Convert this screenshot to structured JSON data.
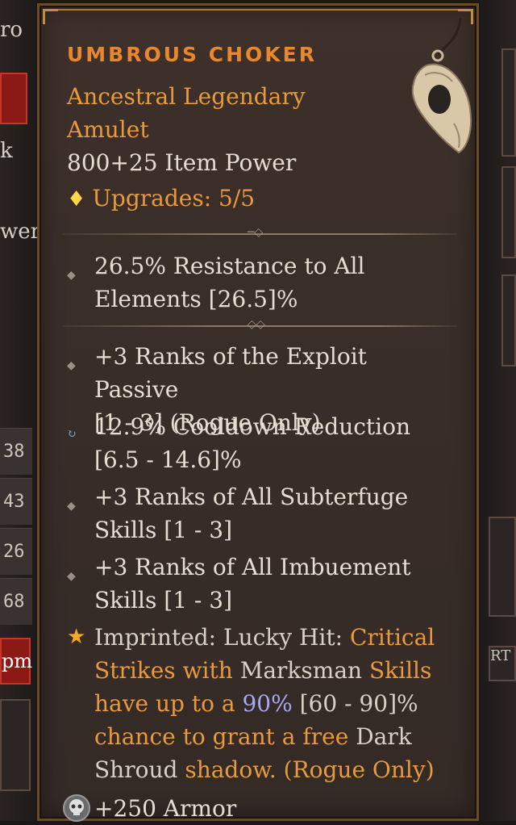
{
  "background": {
    "top_left_text": "ro",
    "left_text_1": "k",
    "left_text_2": "wer",
    "left_numbers": [
      "38",
      "43",
      "26",
      "68"
    ],
    "left_red_label": "pm",
    "right_label": "RT"
  },
  "item": {
    "name": "UMBROUS CHOKER",
    "rarity_line1": "Ancestral Legendary",
    "rarity_line2": "Amulet",
    "item_power": "800+25 Item Power",
    "upgrades": "Upgrades: 5/5"
  },
  "implicit": {
    "line1": "26.5% Resistance to All",
    "line2": "Elements [26.5]%"
  },
  "affixes": [
    {
      "line1": "+3 Ranks of the Exploit Passive",
      "line2": "[1 - 3] (Rogue Only)",
      "icon": "diamond-bullet-icon"
    },
    {
      "line1": "12.9% Cooldown Reduction",
      "line2": "[6.5 - 14.6]%",
      "icon": "reroll-icon"
    },
    {
      "line1": "+3 Ranks of All Subterfuge",
      "line2": "Skills [1 - 3]",
      "icon": "diamond-bullet-icon"
    },
    {
      "line1": "+3 Ranks of All Imbuement",
      "line2": "Skills [1 - 3]",
      "icon": "diamond-bullet-icon"
    }
  ],
  "aspect": {
    "prefix": "Imprinted: Lucky Hit: ",
    "p1": "Critical",
    "p2": "Strikes with ",
    "p3": "Marksman",
    "p4": " Skills",
    "p5": "have up to a ",
    "p6": "90%",
    "p7": " [60 - 90]%",
    "p8": "chance to grant a free ",
    "p9": "Dark",
    "p10": "Shroud",
    "p11": " shadow. (Rogue Only)"
  },
  "armor": "+250 Armor",
  "icons": {
    "upgrade": "diamond-upgrade-icon",
    "aspect": "star-icon",
    "armor": "skull-icon",
    "amulet": "skull-amulet-icon"
  },
  "colors": {
    "legendary_orange": "#e89a3c",
    "upgrade_yellow": "#ffd64a",
    "value_blue": "#a6a8f5"
  }
}
